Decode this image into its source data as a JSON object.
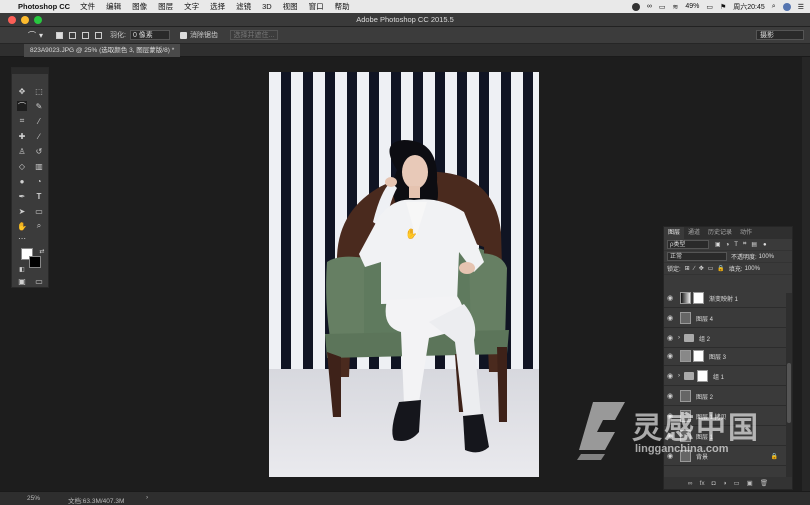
{
  "menubar": {
    "app_name": "Photoshop CC",
    "items": [
      "文件",
      "编辑",
      "图像",
      "图层",
      "文字",
      "选择",
      "滤镜",
      "3D",
      "视图",
      "窗口",
      "帮助"
    ],
    "battery": "49%",
    "clock": "周六20:45"
  },
  "window": {
    "title": "Adobe Photoshop CC 2015.5"
  },
  "options": {
    "feather_label": "羽化:",
    "feather_value": "0 像素",
    "antialias_label": "消除锯齿",
    "select_mask_button": "选择并遮住...",
    "workspace": "摄影"
  },
  "document": {
    "tab": "823A9023.JPG @ 25% (选取颜色 3, 图层蒙版/8) *"
  },
  "status": {
    "zoom": "25%",
    "doc_size": "文档:63.3M/407.3M",
    "arrow": "›"
  },
  "layers_panel": {
    "tabs": [
      "图层",
      "通道",
      "历史记录",
      "动作"
    ],
    "filter_label": "ρ类型",
    "blend_mode": "正常",
    "opacity_label": "不透明度:",
    "opacity_value": "100%",
    "lock_label": "锁定:",
    "fill_label": "填充:",
    "fill_value": "100%",
    "layers": [
      {
        "name": "渐变映射 1"
      },
      {
        "name": "图层 4"
      },
      {
        "name": "组 2"
      },
      {
        "name": "图层 3"
      },
      {
        "name": "组 1"
      },
      {
        "name": "图层 2"
      },
      {
        "name": "图层 1 拷贝"
      },
      {
        "name": "图层 1"
      },
      {
        "name": "背景"
      }
    ],
    "bottom_icons": [
      "∞",
      "fx",
      "◘",
      "◑",
      "▭",
      "▣",
      "🗑"
    ]
  },
  "watermark": {
    "title": "灵感中国",
    "subtitle": "lingganchina.com"
  },
  "colors": {
    "menubar": "#e9e9e9",
    "panel": "#3a3a3a",
    "canvas_bg": "#1d1d1d",
    "stripe_dark": "#101423"
  }
}
